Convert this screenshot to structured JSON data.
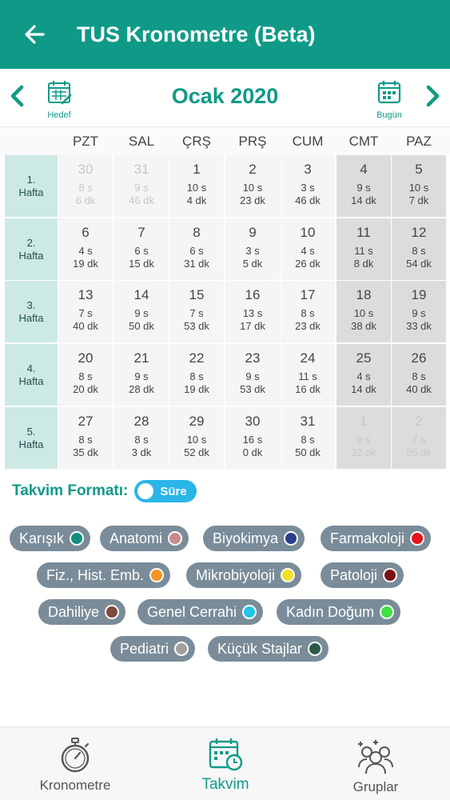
{
  "appbar": {
    "title": "TUS Kronometre (Beta)"
  },
  "month": {
    "title": "Ocak 2020",
    "hedef_label": "Hedef",
    "bugun_label": "Bugün"
  },
  "day_headers": [
    "PZT",
    "SAL",
    "ÇRŞ",
    "PRŞ",
    "CUM",
    "CMT",
    "PAZ"
  ],
  "weeks": [
    {
      "num": "1.",
      "label": "Hafta",
      "days": [
        {
          "day": "30",
          "s": "8 s",
          "dk": "6 dk",
          "faded": true
        },
        {
          "day": "31",
          "s": "9 s",
          "dk": "46 dk",
          "faded": true
        },
        {
          "day": "1",
          "s": "10 s",
          "dk": "4 dk"
        },
        {
          "day": "2",
          "s": "10 s",
          "dk": "23 dk"
        },
        {
          "day": "3",
          "s": "3 s",
          "dk": "46 dk"
        },
        {
          "day": "4",
          "s": "9 s",
          "dk": "14 dk"
        },
        {
          "day": "5",
          "s": "10 s",
          "dk": "7 dk"
        }
      ]
    },
    {
      "num": "2.",
      "label": "Hafta",
      "days": [
        {
          "day": "6",
          "s": "4 s",
          "dk": "19 dk"
        },
        {
          "day": "7",
          "s": "6 s",
          "dk": "15 dk"
        },
        {
          "day": "8",
          "s": "6 s",
          "dk": "31 dk"
        },
        {
          "day": "9",
          "s": "3 s",
          "dk": "5 dk"
        },
        {
          "day": "10",
          "s": "4 s",
          "dk": "26 dk"
        },
        {
          "day": "11",
          "s": "11 s",
          "dk": "8 dk"
        },
        {
          "day": "12",
          "s": "8 s",
          "dk": "54 dk"
        }
      ]
    },
    {
      "num": "3.",
      "label": "Hafta",
      "days": [
        {
          "day": "13",
          "s": "7 s",
          "dk": "40 dk"
        },
        {
          "day": "14",
          "s": "9 s",
          "dk": "50 dk"
        },
        {
          "day": "15",
          "s": "7 s",
          "dk": "53 dk"
        },
        {
          "day": "16",
          "s": "13 s",
          "dk": "17 dk"
        },
        {
          "day": "17",
          "s": "8 s",
          "dk": "23 dk"
        },
        {
          "day": "18",
          "s": "10 s",
          "dk": "38 dk"
        },
        {
          "day": "19",
          "s": "9 s",
          "dk": "33 dk"
        }
      ]
    },
    {
      "num": "4.",
      "label": "Hafta",
      "days": [
        {
          "day": "20",
          "s": "8 s",
          "dk": "20 dk"
        },
        {
          "day": "21",
          "s": "9 s",
          "dk": "28 dk"
        },
        {
          "day": "22",
          "s": "8 s",
          "dk": "19 dk"
        },
        {
          "day": "23",
          "s": "9 s",
          "dk": "53 dk"
        },
        {
          "day": "24",
          "s": "11 s",
          "dk": "16 dk"
        },
        {
          "day": "25",
          "s": "4 s",
          "dk": "14 dk"
        },
        {
          "day": "26",
          "s": "8 s",
          "dk": "40 dk"
        }
      ]
    },
    {
      "num": "5.",
      "label": "Hafta",
      "days": [
        {
          "day": "27",
          "s": "8 s",
          "dk": "35 dk"
        },
        {
          "day": "28",
          "s": "8 s",
          "dk": "3 dk"
        },
        {
          "day": "29",
          "s": "10 s",
          "dk": "52 dk"
        },
        {
          "day": "30",
          "s": "16 s",
          "dk": "0 dk"
        },
        {
          "day": "31",
          "s": "8 s",
          "dk": "50 dk"
        },
        {
          "day": "1",
          "s": "9 s",
          "dk": "32 dk",
          "faded": true
        },
        {
          "day": "2",
          "s": "7 s",
          "dk": "55 dk",
          "faded": true
        }
      ]
    }
  ],
  "format": {
    "label": "Takvim Formatı:",
    "toggle_label": "Süre"
  },
  "legend": [
    {
      "name": "Karışık",
      "color": "#138f80"
    },
    {
      "name": "Anatomi",
      "color": "#c98a8a"
    },
    {
      "name": "Biyokimya",
      "color": "#2b3f8f"
    },
    {
      "name": "Farmakoloji",
      "color": "#e5141e"
    },
    {
      "name": "Fiz., Hist. Emb.",
      "color": "#f5941e"
    },
    {
      "name": "Mikrobiyoloji",
      "color": "#f3e02a"
    },
    {
      "name": "Patoloji",
      "color": "#7a0f12"
    },
    {
      "name": "Dahiliye",
      "color": "#7d4a3d"
    },
    {
      "name": "Genel Cerrahi",
      "color": "#22c3e8"
    },
    {
      "name": "Kadın Doğum",
      "color": "#3ee13e"
    },
    {
      "name": "Pediatri",
      "color": "#a0a0a0"
    },
    {
      "name": "Küçük Stajlar",
      "color": "#2c5a48"
    }
  ],
  "bottom_nav": [
    {
      "label": "Kronometre",
      "icon": "stopwatch-icon",
      "active": false
    },
    {
      "label": "Takvim",
      "icon": "calendar-clock-icon",
      "active": true
    },
    {
      "label": "Gruplar",
      "icon": "group-icon",
      "active": false
    }
  ],
  "colors": {
    "primary": "#0f9a87",
    "toggle": "#29b5e8",
    "chip_bg": "#7a8c99"
  }
}
